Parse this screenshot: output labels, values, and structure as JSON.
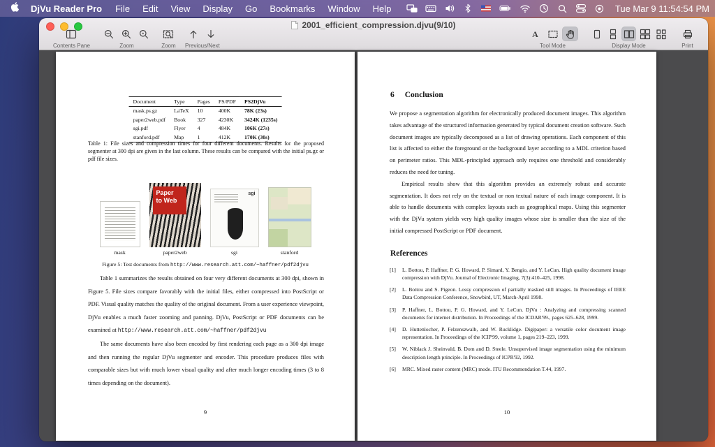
{
  "colors": {
    "traffic_red": "#ff5f57",
    "traffic_yellow": "#febc2e",
    "traffic_green": "#28c840",
    "active_tool_highlight": "#c2c2c7",
    "menubar_tint": "#8273aa",
    "paper_cover_red": "#c0251c"
  },
  "menubar": {
    "app_name": "DjVu Reader Pro",
    "menus": [
      "File",
      "Edit",
      "View",
      "Display",
      "Go",
      "Bookmarks",
      "Window",
      "Help"
    ],
    "status_icons": [
      "display-icon",
      "keyboard-icon",
      "volume-icon",
      "bluetooth-icon",
      "input-source-flag-icon",
      "battery-icon",
      "wifi-icon",
      "clock-icon",
      "spotlight-icon",
      "control-center-icon",
      "siri-icon"
    ],
    "datetime": "Tue Mar 9 11:54:54 PM"
  },
  "window": {
    "title": "2001_efficient_compression.djvu(9/10)",
    "toolbar": {
      "contents_pane_label": "Contents Pane",
      "zoom_label": "Zoom",
      "zoom2_label": "Zoom",
      "prev_next_label": "Previous/Next",
      "tool_mode_label": "Tool Mode",
      "display_mode_label": "Display Mode",
      "print_label": "Print",
      "text_tool_glyph": "A"
    }
  },
  "document": {
    "left_page": {
      "table": {
        "headers": [
          "Document",
          "Type",
          "Pages",
          "PS/PDF",
          "PS2DjVu"
        ],
        "rows": [
          [
            "mask.ps.gz",
            "LaTeX",
            "10",
            "400K",
            "78K (23s)"
          ],
          [
            "paper2web.pdf",
            "Book",
            "327",
            "4230K",
            "3424K (1235s)"
          ],
          [
            "sgi.pdf",
            "Flyer",
            "4",
            "484K",
            "106K (27s)"
          ],
          [
            "stanford.pdf",
            "Map",
            "1",
            "412K",
            "170K (30s)"
          ]
        ]
      },
      "table_caption": "Table 1: File sizes and compression times for four different documents. Results for the proposed segmenter at 300 dpi are given in the last column. These results can be compared with the initial ps.gz or pdf file sizes.",
      "figure": {
        "images": [
          {
            "label": "mask"
          },
          {
            "label": "paper2web",
            "cover_line1": "Paper",
            "cover_line2": "to Web"
          },
          {
            "label": "sgi",
            "logo": "sgi"
          },
          {
            "label": "stanford"
          }
        ],
        "caption_prefix": "Figure 5: Test documents from ",
        "caption_url": "http://www.research.att.com/~haffner/pdf2djvu"
      },
      "para1_text": "Table 1 summarizes the results obtained on four very different documents at 300 dpi, shown in Figure 5. File sizes compare favorably with the initial files, either compressed into PostScript or PDF. Visual quality matches the quality of the original document. From a user experience viewpoint, DjVu enables a much faster zooming and panning. DjVu, PostScript or PDF documents can be examined at ",
      "para1_url": "http://www.research.att.com/~haffner/pdf2djvu",
      "para2": "The same documents have also been encoded by first rendering each page as a 300 dpi image and then running the regular DjVu segmenter and encoder. This procedure produces files with comparable sizes but with much lower visual quality and after much longer encoding times (3 to 8 times depending on the document).",
      "page_number": "9"
    },
    "right_page": {
      "section_number": "6",
      "section_title": "Conclusion",
      "para1": "We propose a segmentation algorithm for electronically produced document images. This algorithm takes advantage of the structured information generated by typical document creation software. Such document images are typically decomposed as a list of drawing operations. Each component of this list is affected to either the foreground or the background layer according to a MDL criterion based on perimeter ratios. This MDL-principled approach only requires one threshold and considerably reduces the need for tuning.",
      "para2": "Empirical results show that this algorithm provides an extremely robust and accurate segmentation. It does not rely on the textual or non textual nature of each image component. It is able to handle documents with complex layouts such as geographical maps. Using this segmenter with the DjVu system yields very high quality images whose size is smaller than the size of the initial compressed PostScript or PDF document.",
      "references_title": "References",
      "references": [
        {
          "label": "[1]",
          "text": "L. Bottou, P. Haffner, P. G. Howard, P. Simard, Y. Bengio, and Y. LeCun. High quality document image compression with DjVu. Journal of Electronic Imaging, 7(3):410–425, 1998."
        },
        {
          "label": "[2]",
          "text": "L. Bottou and S. Pigeon. Lossy compression of partially masked still images. In Proceedings of IEEE Data Compression Conference, Snowbird, UT, March-April 1998."
        },
        {
          "label": "[3]",
          "text": "P. Haffner, L. Bottou, P. G. Howard, and Y. LeCun. DjVu : Analyzing and compressing scanned documents for internet distribution. In Proceedings of the ICDAR'99., pages 625–628, 1999."
        },
        {
          "label": "[4]",
          "text": "D. Huttenlocher, P. Felzenszwalb, and W. Rucklidge. Digipaper: a versatile color document image representation. In Proceedings of the ICIP'99, volume 1, pages 219–223, 1999."
        },
        {
          "label": "[5]",
          "text": "W. Niblack J. Sheinvald, B. Dom and D. Steele. Unsupervised image segmentation using the minimum description length principle. In Proceedings of ICPR'92, 1992."
        },
        {
          "label": "[6]",
          "text": "MRC. Mixed raster content (MRC) mode. ITU Recommendation T.44, 1997."
        }
      ],
      "page_number": "10"
    }
  }
}
